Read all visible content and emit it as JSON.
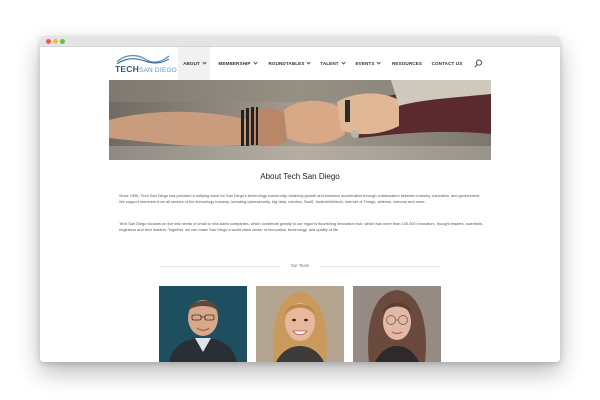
{
  "window": {
    "controls": [
      "close",
      "minimize",
      "maximize"
    ]
  },
  "header": {
    "logo": {
      "main": "TECH",
      "sub": "SAN DIEGO"
    },
    "nav": [
      {
        "label": "ABOUT",
        "dropdown": true,
        "active": true
      },
      {
        "label": "MEMBERSHIP",
        "dropdown": true
      },
      {
        "label": "ROUNDTABLES",
        "dropdown": true
      },
      {
        "label": "TALENT",
        "dropdown": true
      },
      {
        "label": "EVENTS",
        "dropdown": true
      },
      {
        "label": "RESOURCES",
        "dropdown": false
      },
      {
        "label": "CONTACT US",
        "dropdown": false
      }
    ],
    "search_icon": "search-icon"
  },
  "hero": {
    "image": "hands-fist-bump"
  },
  "about": {
    "title": "About Tech San Diego",
    "paragraph1": "Since 1996, Tech San Diego has provided a unifying voice for San Diego's technology community, fostering growth and business acceleration through collaboration between industry, education, and government. We support members from all sectors of the technology industry, including cybersecurity, big data, robotics, SaaS, biotech/infotech, Internet of Things, defense, telecom and more.",
    "paragraph2": "Tech San Diego focuses on the real needs of small to mid-sized companies, which contribute greatly to our region's flourishing innovation hub, which has more than 100,000 innovators, thought leaders, scientists, engineers and tech leaders. Together, we can make San Diego a world class center of innovation, technology, and quality of life."
  },
  "team": {
    "label": "Our Team",
    "members": [
      {
        "photo": "man-with-glasses"
      },
      {
        "photo": "woman-smiling"
      },
      {
        "photo": "woman-with-glasses"
      }
    ]
  },
  "colors": {
    "logo_blue": "#2a5a8a",
    "accent_blue": "#5a95c9",
    "text": "#555555"
  }
}
